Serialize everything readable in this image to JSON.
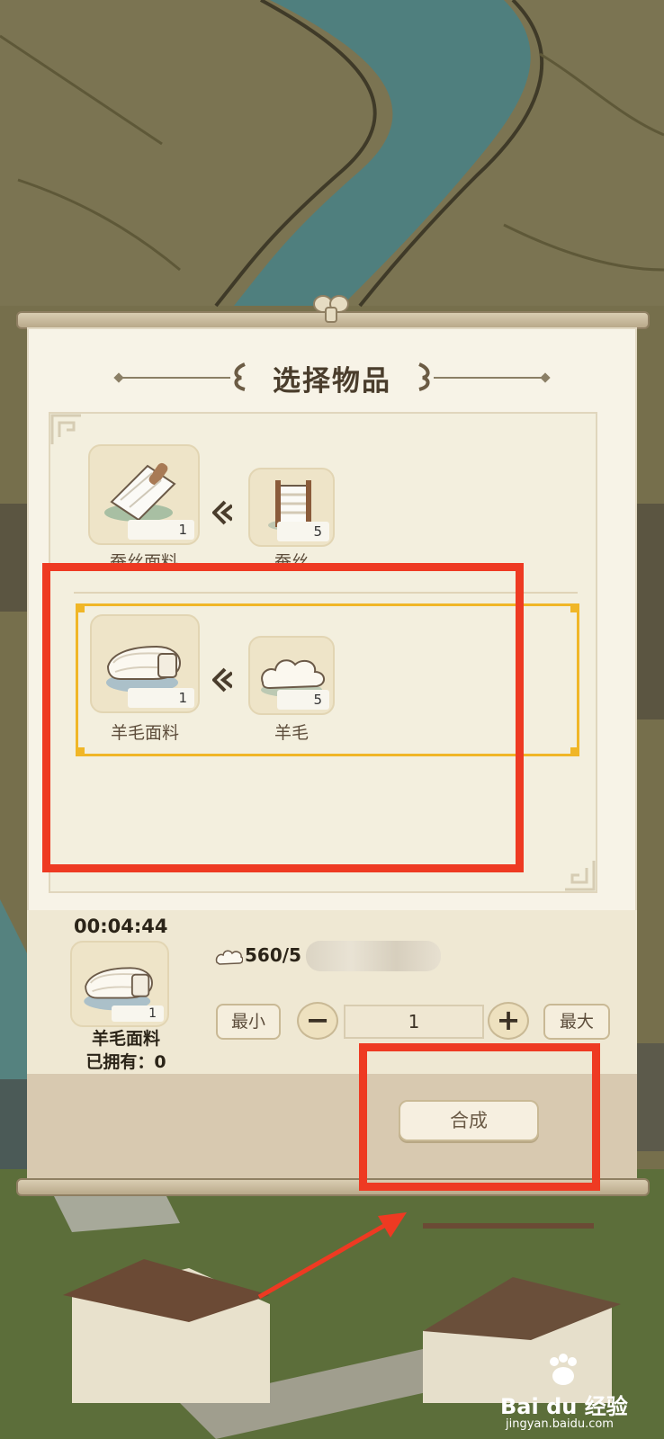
{
  "dialog": {
    "title": "选择物品"
  },
  "recipes": [
    {
      "product": "蚕丝面料",
      "product_count": "1",
      "ingredient": "蚕丝",
      "ingredient_count": "5"
    },
    {
      "product": "羊毛面料",
      "product_count": "1",
      "ingredient": "羊毛",
      "ingredient_count": "5"
    }
  ],
  "production": {
    "timer": "00:04:44",
    "resource": "560/5",
    "product_name": "羊毛面料",
    "product_count": "1",
    "owned": "已拥有：0",
    "min_label": "最小",
    "max_label": "最大",
    "quantity": "1",
    "minus_label": "−",
    "plus_label": "+",
    "synth_label": "合成"
  },
  "watermark": {
    "brand": "Bai du 经验",
    "url": "jingyan.baidu.com"
  },
  "colors": {
    "highlight_red": "#ee3a22",
    "selection_gold": "#f0b627",
    "panel": "#f7f3e7"
  }
}
